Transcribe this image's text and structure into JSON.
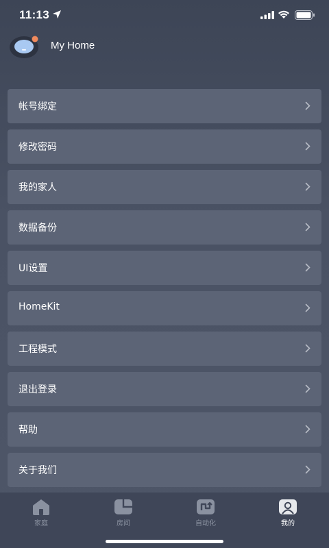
{
  "status": {
    "time": "11:13"
  },
  "profile": {
    "name": "My Home"
  },
  "menu": [
    {
      "label": "帐号绑定"
    },
    {
      "label": "修改密码"
    },
    {
      "label": "我的家人"
    },
    {
      "label": "数据备份"
    },
    {
      "label": "UI设置"
    },
    {
      "label": "HomeKit"
    },
    {
      "label": "工程模式"
    },
    {
      "label": "退出登录"
    },
    {
      "label": "帮助"
    },
    {
      "label": "关于我们"
    }
  ],
  "tabs": [
    {
      "label": "家庭",
      "icon": "home-icon",
      "active": false
    },
    {
      "label": "房间",
      "icon": "room-icon",
      "active": false
    },
    {
      "label": "自动化",
      "icon": "automation-icon",
      "active": false
    },
    {
      "label": "我的",
      "icon": "profile-icon",
      "active": true
    }
  ],
  "colors": {
    "accent_badge": "#f08a5d",
    "card": "#5c6476",
    "tab_inactive": "#8a91a0"
  }
}
